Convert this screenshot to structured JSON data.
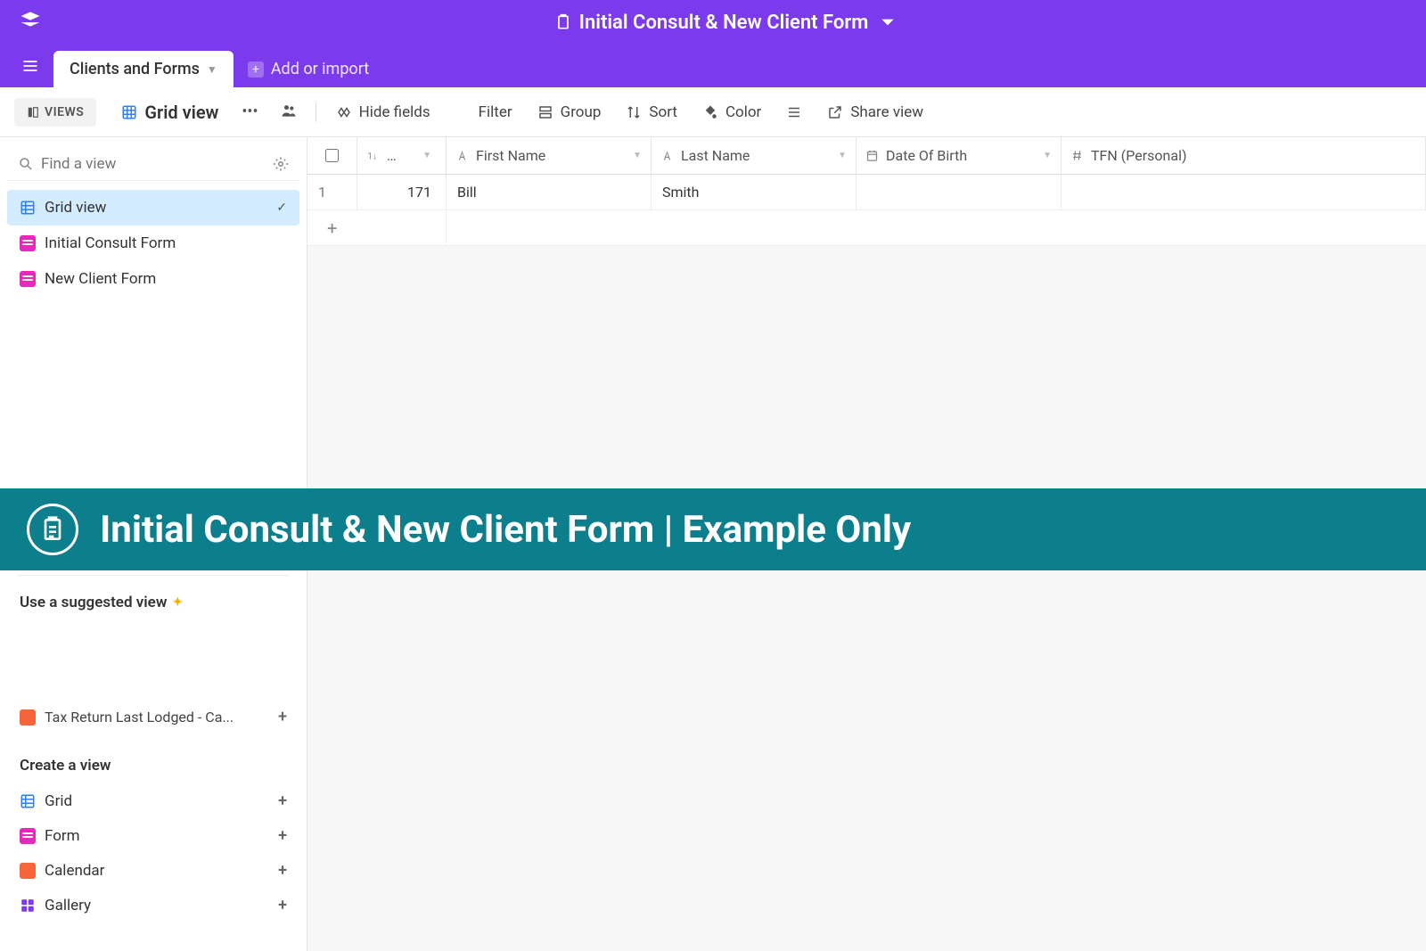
{
  "header": {
    "title": "Initial Consult & New Client Form"
  },
  "tabs": {
    "active": "Clients and Forms",
    "add_import": "Add or import"
  },
  "toolbar": {
    "views": "VIEWS",
    "gridview": "Grid view",
    "hide_fields": "Hide fields",
    "filter": "Filter",
    "group": "Group",
    "sort": "Sort",
    "color": "Color",
    "share": "Share view"
  },
  "sidebar": {
    "search_placeholder": "Find a view",
    "views": [
      {
        "type": "grid",
        "label": "Grid view",
        "active": true
      },
      {
        "type": "form",
        "label": "Initial Consult Form"
      },
      {
        "type": "form",
        "label": "New Client Form"
      }
    ],
    "suggested_title": "Use a suggested view",
    "suggested_item": "Tax Return Last Lodged - Ca...",
    "create_title": "Create a view",
    "create": [
      {
        "type": "grid",
        "label": "Grid"
      },
      {
        "type": "form",
        "label": "Form"
      },
      {
        "type": "calendar",
        "label": "Calendar"
      },
      {
        "type": "gallery",
        "label": "Gallery"
      }
    ]
  },
  "grid": {
    "columns": [
      {
        "name": "…",
        "key": "id_sort"
      },
      {
        "name": "First Name",
        "icon": "text"
      },
      {
        "name": "Last Name",
        "icon": "text"
      },
      {
        "name": "Date Of Birth",
        "icon": "date"
      },
      {
        "name": "TFN (Personal)",
        "icon": "hash"
      }
    ],
    "rows": [
      {
        "n": "1",
        "id": "171",
        "first": "Bill",
        "last": "Smith",
        "dob": "",
        "tfn": ""
      }
    ]
  },
  "banner": {
    "text": "Initial Consult & New Client Form | Example Only"
  }
}
